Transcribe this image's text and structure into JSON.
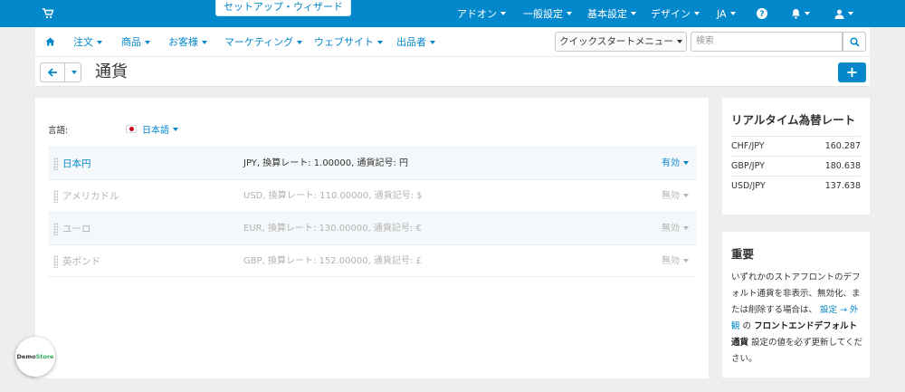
{
  "topbar": {
    "wizard_label": "セットアップ・ウィザード",
    "items": [
      {
        "label": "アドオン"
      },
      {
        "label": "一般設定"
      },
      {
        "label": "基本設定"
      },
      {
        "label": "デザイン"
      },
      {
        "label": "JA"
      }
    ]
  },
  "menu": {
    "items": [
      {
        "label": "注文"
      },
      {
        "label": "商品"
      },
      {
        "label": "お客様"
      },
      {
        "label": "マーケティング"
      },
      {
        "label": "ウェブサイト"
      },
      {
        "label": "出品者"
      }
    ],
    "quickstart_label": "クイックスタートメニュー",
    "search_placeholder": "検索"
  },
  "page": {
    "title": "通貨",
    "add_label": "+"
  },
  "language": {
    "label": "言語:",
    "value": "日本語"
  },
  "currencies": [
    {
      "name": "日本円",
      "desc": "JPY, 換算レート: 1.00000, 通貨記号: 円",
      "status": "有効",
      "state": "enabled"
    },
    {
      "name": "アメリカドル",
      "desc": "USD, 換算レート: 110.00000, 通貨記号: $",
      "status": "無効",
      "state": "disabled"
    },
    {
      "name": "ユーロ",
      "desc": "EUR, 換算レート: 130.00000, 通貨記号: €",
      "status": "無効",
      "state": "disabled"
    },
    {
      "name": "英ポンド",
      "desc": "GBP, 換算レート: 152.00000, 通貨記号: £",
      "status": "無効",
      "state": "disabled"
    }
  ],
  "rates": {
    "title": "リアルタイム為替レート",
    "items": [
      {
        "pair": "CHF/JPY",
        "value": "160.287"
      },
      {
        "pair": "GBP/JPY",
        "value": "180.638"
      },
      {
        "pair": "USD/JPY",
        "value": "137.638"
      }
    ]
  },
  "important": {
    "title": "重要",
    "text1": "いずれかのストアフロントのデフォルト通貨を非表示、無効化、または削除する場合は、",
    "link": "設定 → 外観",
    "text2": "の",
    "bold": "フロントエンドデフォルト通貨",
    "text3": "設定の値を必ず更新してください。"
  },
  "badge": {
    "demo": "Demo",
    "store": "Store"
  }
}
